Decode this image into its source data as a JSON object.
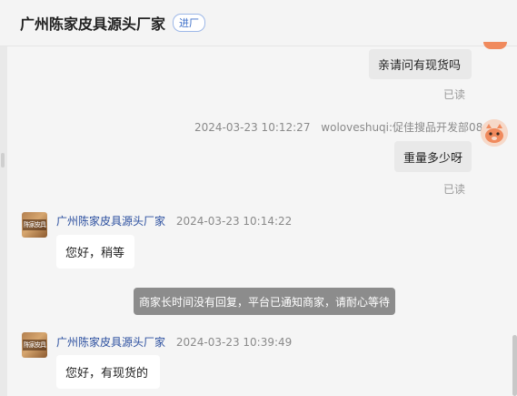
{
  "header": {
    "title": "广州陈家皮具源头厂家",
    "badge": "进厂"
  },
  "messages": [
    {
      "side": "right",
      "text": "亲请问有现货吗",
      "status": "已读"
    },
    {
      "side": "right",
      "time": "2024-03-23 10:12:27",
      "sender": "woloveshuqi:促佳搜品开发部086",
      "text": "重量多少呀",
      "status": "已读"
    },
    {
      "side": "left",
      "sender": "广州陈家皮具源头厂家",
      "time": "2024-03-23 10:14:22",
      "text": "您好，稍等"
    },
    {
      "side": "left",
      "sender": "广州陈家皮具源头厂家",
      "time": "2024-03-23 10:39:49",
      "text": "您好，有现货的"
    }
  ],
  "notice": "商家长时间没有回复，平台已通知商家，请耐心等待",
  "shop_avatar_text": "陈家皮具",
  "colors": {
    "name_link": "#2b4f9f",
    "notice_bg": "#8c8c8c",
    "self_avatar": "#f08a5d"
  }
}
